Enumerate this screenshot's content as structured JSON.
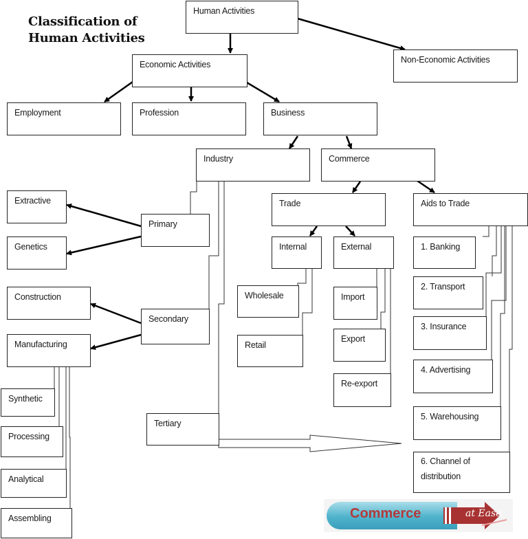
{
  "title": {
    "line1": "Classification of",
    "line2": "Human Activities"
  },
  "nodes": {
    "human_activities": "Human Activities",
    "economic_activities": "Economic Activities",
    "non_economic_activities": "Non-Economic Activities",
    "employment": "Employment",
    "profession": "Profession",
    "business": "Business",
    "industry": "Industry",
    "commerce": "Commerce",
    "primary": "Primary",
    "secondary": "Secondary",
    "tertiary": "Tertiary",
    "extractive": "Extractive",
    "genetics": "Genetics",
    "construction": "Construction",
    "manufacturing": "Manufacturing",
    "synthetic": "Synthetic",
    "processing": "Processing",
    "analytical": "Analytical",
    "assembling": "Assembling",
    "trade": "Trade",
    "aids_to_trade": "Aids to Trade",
    "internal": "Internal",
    "external": "External",
    "wholesale": "Wholesale",
    "retail": "Retail",
    "import": "Import",
    "export": "Export",
    "re_export": "Re-export",
    "banking": "1. Banking",
    "transport": "2. Transport",
    "insurance": "3. Insurance",
    "advertising": "4. Advertising",
    "warehousing": "5. Warehousing",
    "channel_of_distribution": "6. Channel of distribution"
  },
  "logo": {
    "word": "Commerce",
    "tagline": "at Ease",
    "colors": {
      "pill": "#4fb3cc",
      "text": "#b23a3a",
      "arrow": "#a83232"
    }
  }
}
